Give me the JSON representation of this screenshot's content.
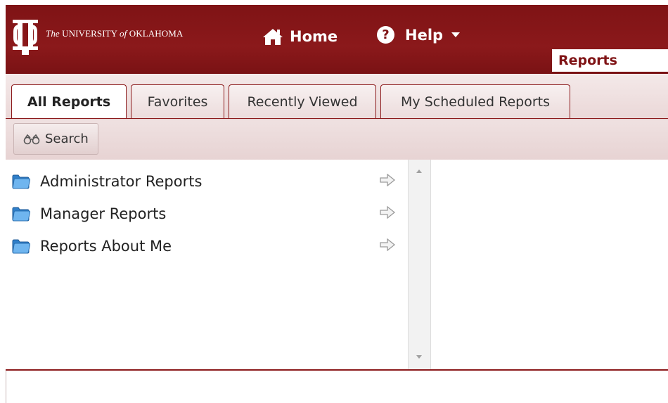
{
  "header": {
    "logo": {
      "prefix": "The",
      "text": "UNIVERSITY",
      "of": "of",
      "name": "OKLAHOMA"
    },
    "nav": {
      "home_label": "Home",
      "help_label": "Help"
    },
    "reports_label": "Reports"
  },
  "tabs": [
    {
      "label": "All Reports",
      "active": true
    },
    {
      "label": "Favorites",
      "active": false
    },
    {
      "label": "Recently Viewed",
      "active": false
    },
    {
      "label": "My Scheduled Reports",
      "active": false
    }
  ],
  "toolbar": {
    "search_label": "Search"
  },
  "folders": [
    {
      "label": "Administrator Reports"
    },
    {
      "label": "Manager Reports"
    },
    {
      "label": "Reports About Me"
    }
  ],
  "icons": {
    "home": "home-icon",
    "help": "help-icon",
    "search": "binoculars-icon",
    "folder": "folder-icon",
    "arrow": "arrow-right-icon"
  },
  "colors": {
    "brand": "#841617",
    "tab_border": "#8b191b"
  }
}
